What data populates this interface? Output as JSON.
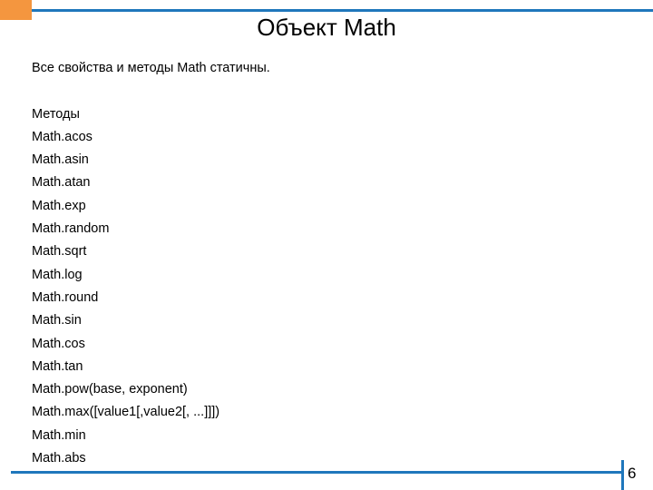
{
  "slide": {
    "title": "Объект Math",
    "page_number": "6",
    "decor": {
      "orange_block_color": "#F4963F",
      "blue_rule_color": "#1F77BC",
      "background_color": "#FFFFFF",
      "text_color": "#000000"
    },
    "body_lines": [
      "Все свойства и методы Math статичны.",
      "",
      "Методы",
      "Math.acos",
      "Math.asin",
      "Math.atan",
      "Math.exp",
      "Math.random",
      "Math.sqrt",
      "Math.log",
      "Math.round",
      "Math.sin",
      "Math.cos",
      "Math.tan",
      "Math.pow(base, exponent)",
      "Math.max([value1[,value2[, ...]]])",
      "Math.min",
      "Math.abs"
    ]
  }
}
